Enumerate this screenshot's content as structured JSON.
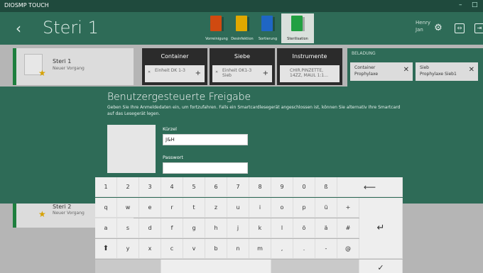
{
  "window": {
    "title": "DIOSMP TOUCH",
    "minimize": "–",
    "restore": "□"
  },
  "header": {
    "back": "‹",
    "title": "Steri 1",
    "tabs": [
      {
        "label": "Vorreinigung",
        "color": "#d04a10"
      },
      {
        "label": "Desinfektion",
        "color": "#e0a800"
      },
      {
        "label": "Sortierung",
        "color": "#1f66c4"
      },
      {
        "label": "Sterilisation",
        "color": "#22a042"
      }
    ],
    "user_first": "Henry",
    "user_last": "Jan"
  },
  "background": {
    "card_top": {
      "name": "Steri 1",
      "status": "Neuer Vorgang"
    },
    "card_bottom": {
      "name": "Steri 2",
      "status": "Neuer Vorgang"
    },
    "columns": [
      {
        "head": "Container",
        "item": "Einheit DK 1-3"
      },
      {
        "head": "Siebe",
        "item": "Einheit OK1-3 Sieb"
      },
      {
        "head": "Instrumente",
        "item": "CHIR.PINZETTE, 14ZZ, MAUL 1:1..."
      }
    ],
    "beladung": {
      "label": "BELADUNG",
      "items": [
        {
          "title": "Container",
          "sub": "Prophylaxe"
        },
        {
          "title": "Sieb",
          "sub": "Prophylaxe Sieb1"
        }
      ]
    }
  },
  "dialog": {
    "title": "Benutzergesteuerte Freigabe",
    "description": "Geben Sie Ihre Anmeldedaten ein, um fortzufahren. Falls ein Smartcardlesegerät angeschlossen ist, können Sie alternativ Ihre Smartcard auf das Lesegerät legen.",
    "kuerzel_label": "Kürzel",
    "kuerzel_value": "J&H",
    "passwort_label": "Passwort",
    "passwort_value": ""
  },
  "keyboard": {
    "row1": [
      "1",
      "2",
      "3",
      "4",
      "5",
      "6",
      "7",
      "8",
      "9",
      "0",
      "ß"
    ],
    "backspace": "⟵",
    "row2": [
      "q",
      "w",
      "e",
      "r",
      "t",
      "z",
      "u",
      "i",
      "o",
      "p",
      "ü",
      "+"
    ],
    "row3": [
      "a",
      "s",
      "d",
      "f",
      "g",
      "h",
      "j",
      "k",
      "l",
      "ö",
      "ä",
      "#"
    ],
    "enter": "↵",
    "shift": "⬆",
    "row4": [
      "y",
      "x",
      "c",
      "v",
      "b",
      "n",
      "m",
      ",",
      ".",
      "-",
      "@"
    ],
    "confirm": "✓"
  }
}
